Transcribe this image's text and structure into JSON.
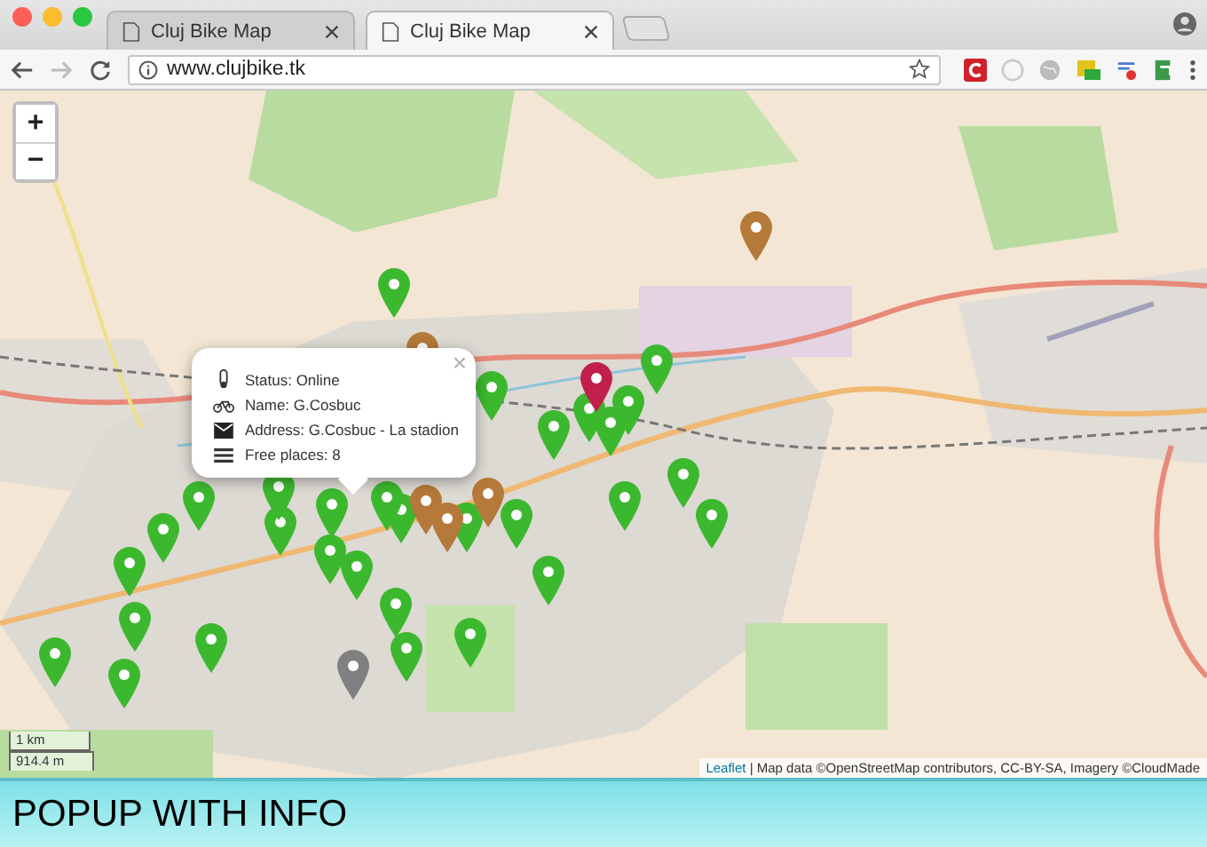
{
  "tabs": [
    {
      "title": "Cluj Bike Map",
      "selected": false
    },
    {
      "title": "Cluj Bike Map",
      "selected": true
    }
  ],
  "address_bar": {
    "url": "www.clujbike.tk"
  },
  "map": {
    "zoom_controls": [
      "+",
      "−"
    ],
    "markers": [
      {
        "color": "#3cb82e"
      },
      {
        "color": "#3cb82e"
      },
      {
        "color": "#3cb82e"
      },
      {
        "color": "#3cb82e"
      },
      {
        "color": "#3cb82e"
      },
      {
        "color": "#3cb82e"
      },
      {
        "color": "#3cb82e"
      },
      {
        "color": "#3cb82e"
      },
      {
        "color": "#3cb82e"
      },
      {
        "color": "#3cb82e"
      },
      {
        "color": "#3cb82e"
      },
      {
        "color": "#3cb82e"
      },
      {
        "color": "#3cb82e"
      },
      {
        "color": "#3cb82e"
      },
      {
        "color": "#3cb82e"
      },
      {
        "color": "#3cb82e"
      },
      {
        "color": "#3cb82e"
      },
      {
        "color": "#3cb82e"
      },
      {
        "color": "#3cb82e"
      },
      {
        "color": "#3cb82e"
      },
      {
        "color": "#3cb82e"
      },
      {
        "color": "#3cb82e"
      },
      {
        "color": "#3cb82e"
      },
      {
        "color": "#3cb82e"
      },
      {
        "color": "#3cb82e"
      },
      {
        "color": "#3cb82e"
      },
      {
        "color": "#3cb82e"
      },
      {
        "color": "#3cb82e"
      },
      {
        "color": "#3cb82e"
      },
      {
        "color": "#3cb82e"
      },
      {
        "color": "#b5793a"
      },
      {
        "color": "#b5793a"
      },
      {
        "color": "#b5793a"
      },
      {
        "color": "#b5793a"
      },
      {
        "color": "#b5793a"
      },
      {
        "color": "#c0204a"
      },
      {
        "color": "#808080"
      }
    ],
    "popup": {
      "close": "×",
      "lines": [
        {
          "kind": "status",
          "text": "Status: Online"
        },
        {
          "kind": "name",
          "text": "Name: G.Cosbuc"
        },
        {
          "kind": "address",
          "text": "Address: G.Cosbuc - La stadion"
        },
        {
          "kind": "places",
          "text": "Free places: 8"
        }
      ]
    },
    "scale": [
      "1 km",
      "914.4 m"
    ],
    "attribution": {
      "link": "Leaflet",
      "text": "| Map data ©OpenStreetMap contributors, CC-BY-SA, Imagery ©CloudMade"
    }
  },
  "caption": "POPUP WITH INFO"
}
